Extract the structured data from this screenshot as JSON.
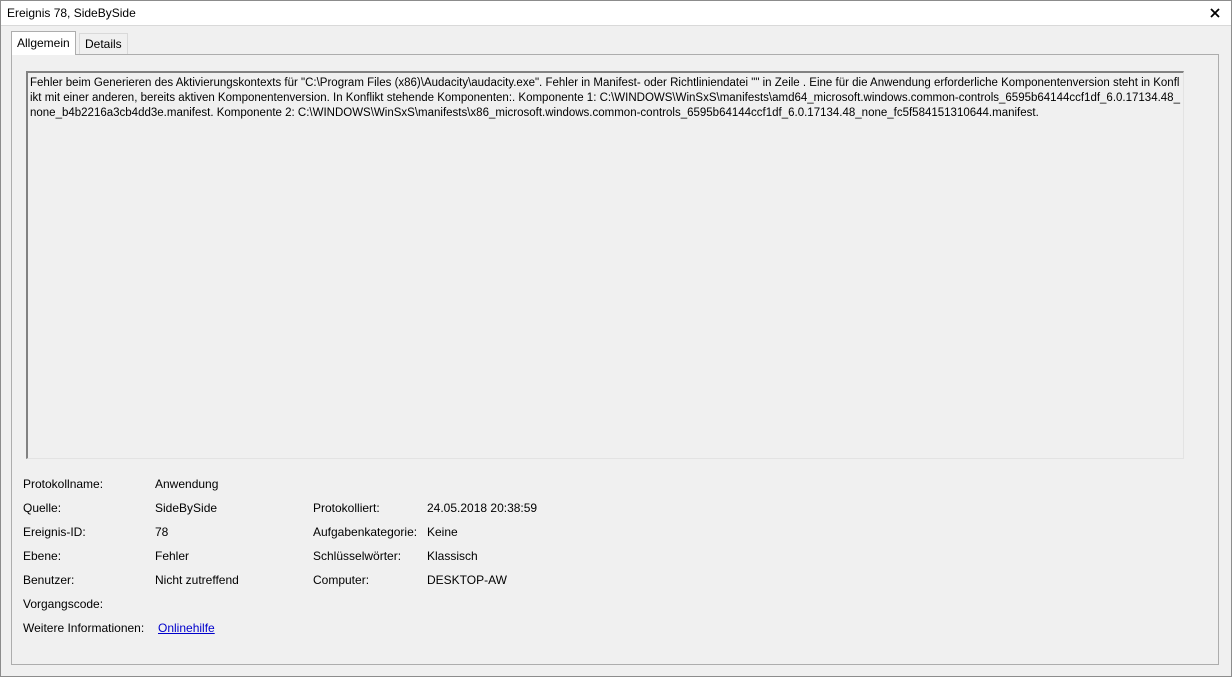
{
  "window": {
    "title": "Ereignis 78, SideBySide",
    "close_symbol": "✕"
  },
  "tabs": [
    {
      "label": "Allgemein",
      "active": true
    },
    {
      "label": "Details",
      "active": false
    }
  ],
  "description": "Fehler beim Generieren des Aktivierungskontexts für \"C:\\Program Files (x86)\\Audacity\\audacity.exe\". Fehler in Manifest- oder Richtliniendatei \"\" in Zeile . Eine für die Anwendung erforderliche Komponentenversion steht in Konflikt mit einer anderen, bereits aktiven Komponentenversion. In Konflikt stehende Komponenten:. Komponente 1: C:\\WINDOWS\\WinSxS\\manifests\\amd64_microsoft.windows.common-controls_6595b64144ccf1df_6.0.17134.48_none_b4b2216a3cb4dd3e.manifest. Komponente 2: C:\\WINDOWS\\WinSxS\\manifests\\x86_microsoft.windows.common-controls_6595b64144ccf1df_6.0.17134.48_none_fc5f584151310644.manifest.",
  "fields": {
    "protokollname": {
      "label": "Protokollname:",
      "value": "Anwendung"
    },
    "quelle": {
      "label": "Quelle:",
      "value": "SideBySide"
    },
    "protokolliert": {
      "label": "Protokolliert:",
      "value": "24.05.2018 20:38:59"
    },
    "ereignis_id": {
      "label": "Ereignis-ID:",
      "value": "78"
    },
    "aufgabenkategorie": {
      "label": "Aufgabenkategorie:",
      "value": "Keine"
    },
    "ebene": {
      "label": "Ebene:",
      "value": "Fehler"
    },
    "schluesselwoerter": {
      "label": "Schlüsselwörter:",
      "value": "Klassisch"
    },
    "benutzer": {
      "label": "Benutzer:",
      "value": "Nicht zutreffend"
    },
    "computer": {
      "label": "Computer:",
      "value": "DESKTOP-AW"
    },
    "vorgangscode": {
      "label": "Vorgangscode:",
      "value": ""
    },
    "weitere_informationen": {
      "label": "Weitere Informationen:",
      "link": "Onlinehilfe"
    }
  },
  "colors": {
    "link": "#0000cc",
    "panel_bg": "#f0f0f0"
  }
}
